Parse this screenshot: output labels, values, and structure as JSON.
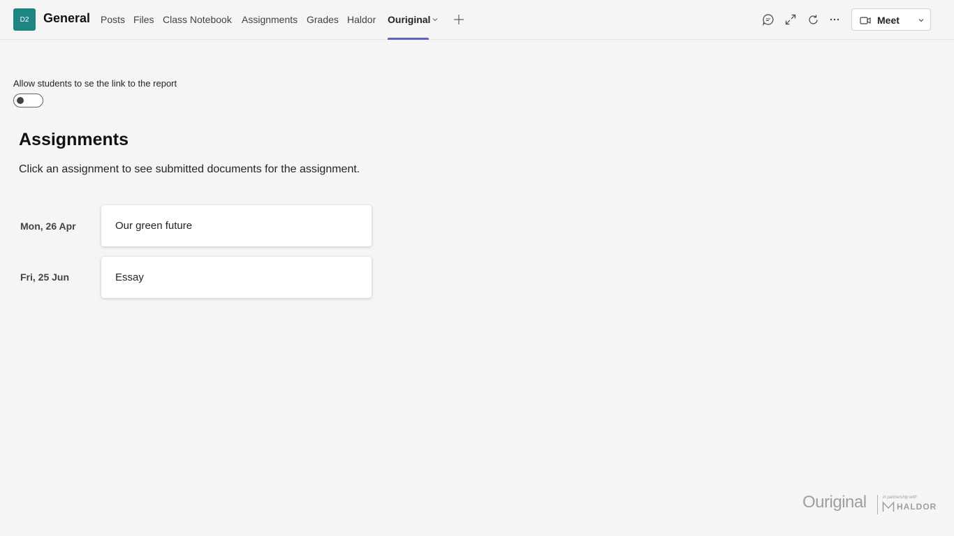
{
  "header": {
    "avatar_text": "D2",
    "channel_title": "General",
    "tabs": [
      {
        "label": "Posts"
      },
      {
        "label": "Files"
      },
      {
        "label": "Class Notebook"
      },
      {
        "label": "Assignments"
      },
      {
        "label": "Grades"
      },
      {
        "label": "Haldor"
      },
      {
        "label": "Ouriginal",
        "active": true
      }
    ],
    "toolbar_icons": [
      "conversation-icon",
      "expand-icon",
      "refresh-icon",
      "more-options-icon"
    ],
    "meet_label": "Meet"
  },
  "settings": {
    "toggle_label": "Allow students to se the link to the report",
    "toggle_on": false
  },
  "assignments": {
    "heading": "Assignments",
    "description": "Click an assignment to see submitted documents for the assignment.",
    "items": [
      {
        "date": "Mon, 26 Apr",
        "title": "Our green future"
      },
      {
        "date": "Fri, 25 Jun",
        "title": "Essay"
      }
    ]
  },
  "footer": {
    "brand": "Ouriginal",
    "partner_text": "in partnership with",
    "partner_brand": "HALDOR"
  },
  "colors": {
    "avatar_bg": "#1f8583",
    "accent": "#5b5fc7",
    "page_bg": "#f5f5f5"
  }
}
